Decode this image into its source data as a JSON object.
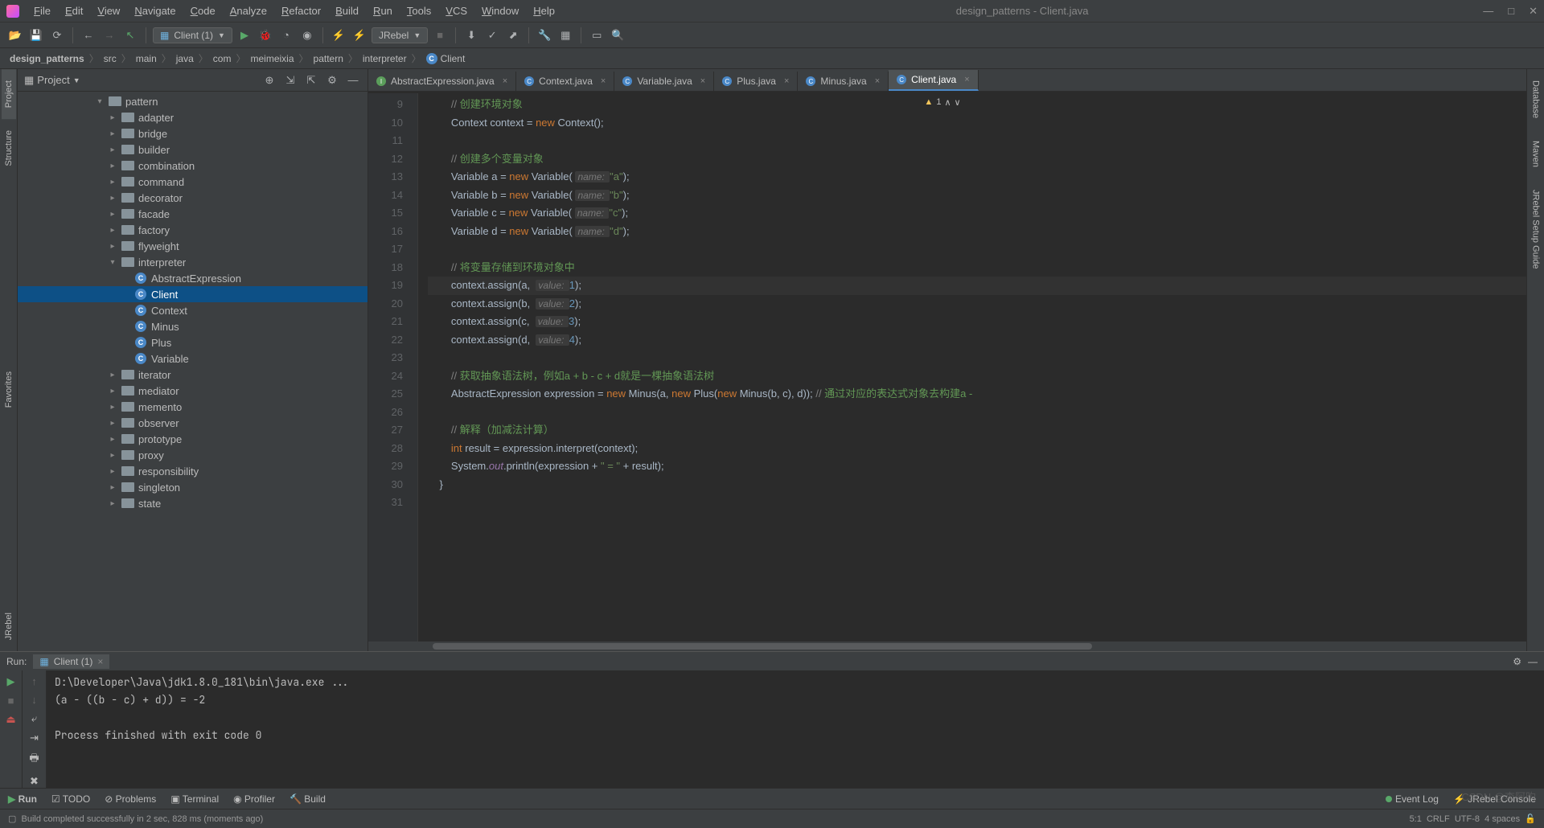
{
  "window": {
    "title": "design_patterns - Client.java"
  },
  "menu": [
    "File",
    "Edit",
    "View",
    "Navigate",
    "Code",
    "Analyze",
    "Refactor",
    "Build",
    "Run",
    "Tools",
    "VCS",
    "Window",
    "Help"
  ],
  "toolbar": {
    "run_config": "Client (1)",
    "jrebel": "JRebel"
  },
  "breadcrumb": [
    "design_patterns",
    "src",
    "main",
    "java",
    "com",
    "meimeixia",
    "pattern",
    "interpreter",
    "Client"
  ],
  "project": {
    "panel_title": "Project",
    "tree": [
      {
        "d": 6,
        "arrow": "v",
        "ico": "folder",
        "label": "pattern"
      },
      {
        "d": 7,
        "arrow": ">",
        "ico": "folder",
        "label": "adapter"
      },
      {
        "d": 7,
        "arrow": ">",
        "ico": "folder",
        "label": "bridge"
      },
      {
        "d": 7,
        "arrow": ">",
        "ico": "folder",
        "label": "builder"
      },
      {
        "d": 7,
        "arrow": ">",
        "ico": "folder",
        "label": "combination"
      },
      {
        "d": 7,
        "arrow": ">",
        "ico": "folder",
        "label": "command"
      },
      {
        "d": 7,
        "arrow": ">",
        "ico": "folder",
        "label": "decorator"
      },
      {
        "d": 7,
        "arrow": ">",
        "ico": "folder",
        "label": "facade"
      },
      {
        "d": 7,
        "arrow": ">",
        "ico": "folder",
        "label": "factory"
      },
      {
        "d": 7,
        "arrow": ">",
        "ico": "folder",
        "label": "flyweight"
      },
      {
        "d": 7,
        "arrow": "v",
        "ico": "folder",
        "label": "interpreter"
      },
      {
        "d": 8,
        "arrow": "",
        "ico": "class",
        "label": "AbstractExpression"
      },
      {
        "d": 8,
        "arrow": "",
        "ico": "class",
        "label": "Client",
        "sel": true
      },
      {
        "d": 8,
        "arrow": "",
        "ico": "class",
        "label": "Context"
      },
      {
        "d": 8,
        "arrow": "",
        "ico": "class",
        "label": "Minus"
      },
      {
        "d": 8,
        "arrow": "",
        "ico": "class",
        "label": "Plus"
      },
      {
        "d": 8,
        "arrow": "",
        "ico": "class",
        "label": "Variable"
      },
      {
        "d": 7,
        "arrow": ">",
        "ico": "folder",
        "label": "iterator"
      },
      {
        "d": 7,
        "arrow": ">",
        "ico": "folder",
        "label": "mediator"
      },
      {
        "d": 7,
        "arrow": ">",
        "ico": "folder",
        "label": "memento"
      },
      {
        "d": 7,
        "arrow": ">",
        "ico": "folder",
        "label": "observer"
      },
      {
        "d": 7,
        "arrow": ">",
        "ico": "folder",
        "label": "prototype"
      },
      {
        "d": 7,
        "arrow": ">",
        "ico": "folder",
        "label": "proxy"
      },
      {
        "d": 7,
        "arrow": ">",
        "ico": "folder",
        "label": "responsibility"
      },
      {
        "d": 7,
        "arrow": ">",
        "ico": "folder",
        "label": "singleton"
      },
      {
        "d": 7,
        "arrow": ">",
        "ico": "folder",
        "label": "state"
      }
    ]
  },
  "tabs": [
    {
      "label": "AbstractExpression.java",
      "ico": "iface"
    },
    {
      "label": "Context.java",
      "ico": "class"
    },
    {
      "label": "Variable.java",
      "ico": "class"
    },
    {
      "label": "Plus.java",
      "ico": "class"
    },
    {
      "label": "Minus.java",
      "ico": "class"
    },
    {
      "label": "Client.java",
      "ico": "class",
      "active": true
    }
  ],
  "editor": {
    "inspection_count": "1",
    "lines_start": 9,
    "lines_end": 31,
    "highlight_line": 19,
    "code": [
      {
        "indent": 8,
        "seg": [
          {
            "t": "// ",
            "c": "cm"
          },
          {
            "t": "创建环境对象",
            "c": "cmcn"
          }
        ]
      },
      {
        "indent": 8,
        "seg": [
          {
            "t": "Context context = "
          },
          {
            "t": "new ",
            "c": "kw"
          },
          {
            "t": "Context();"
          }
        ]
      },
      {
        "indent": 8,
        "seg": []
      },
      {
        "indent": 8,
        "seg": [
          {
            "t": "// ",
            "c": "cm"
          },
          {
            "t": "创建多个变量对象",
            "c": "cmcn"
          }
        ]
      },
      {
        "indent": 8,
        "seg": [
          {
            "t": "Variable a = "
          },
          {
            "t": "new ",
            "c": "kw"
          },
          {
            "t": "Variable( "
          },
          {
            "t": "name: ",
            "c": "hint"
          },
          {
            "t": "\"a\"",
            "c": "str"
          },
          {
            "t": ");"
          }
        ]
      },
      {
        "indent": 8,
        "seg": [
          {
            "t": "Variable b = "
          },
          {
            "t": "new ",
            "c": "kw"
          },
          {
            "t": "Variable( "
          },
          {
            "t": "name: ",
            "c": "hint"
          },
          {
            "t": "\"b\"",
            "c": "str"
          },
          {
            "t": ");"
          }
        ]
      },
      {
        "indent": 8,
        "seg": [
          {
            "t": "Variable c = "
          },
          {
            "t": "new ",
            "c": "kw"
          },
          {
            "t": "Variable( "
          },
          {
            "t": "name: ",
            "c": "hint"
          },
          {
            "t": "\"c\"",
            "c": "str"
          },
          {
            "t": ");"
          }
        ]
      },
      {
        "indent": 8,
        "seg": [
          {
            "t": "Variable d = "
          },
          {
            "t": "new ",
            "c": "kw"
          },
          {
            "t": "Variable( "
          },
          {
            "t": "name: ",
            "c": "hint"
          },
          {
            "t": "\"d\"",
            "c": "str"
          },
          {
            "t": ");"
          }
        ]
      },
      {
        "indent": 8,
        "seg": []
      },
      {
        "indent": 8,
        "seg": [
          {
            "t": "// ",
            "c": "cm"
          },
          {
            "t": "将变量存储到环境对象中",
            "c": "cmcn"
          }
        ]
      },
      {
        "indent": 8,
        "seg": [
          {
            "t": "context.assign(a,  "
          },
          {
            "t": "value: ",
            "c": "hint"
          },
          {
            "t": "1",
            "c": "num"
          },
          {
            "t": ");"
          }
        ],
        "hl": true
      },
      {
        "indent": 8,
        "seg": [
          {
            "t": "context.assign(b,  "
          },
          {
            "t": "value: ",
            "c": "hint"
          },
          {
            "t": "2",
            "c": "num"
          },
          {
            "t": ");"
          }
        ]
      },
      {
        "indent": 8,
        "seg": [
          {
            "t": "context.assign(c,  "
          },
          {
            "t": "value: ",
            "c": "hint"
          },
          {
            "t": "3",
            "c": "num"
          },
          {
            "t": ");"
          }
        ]
      },
      {
        "indent": 8,
        "seg": [
          {
            "t": "context.assign(d,  "
          },
          {
            "t": "value: ",
            "c": "hint"
          },
          {
            "t": "4",
            "c": "num"
          },
          {
            "t": ");"
          }
        ]
      },
      {
        "indent": 8,
        "seg": []
      },
      {
        "indent": 8,
        "seg": [
          {
            "t": "// ",
            "c": "cm"
          },
          {
            "t": "获取抽象语法树，例如a + b - c + d就是一棵抽象语法树",
            "c": "cmcn"
          }
        ]
      },
      {
        "indent": 8,
        "seg": [
          {
            "t": "AbstractExpression expression = "
          },
          {
            "t": "new ",
            "c": "kw"
          },
          {
            "t": "Minus(a, "
          },
          {
            "t": "new ",
            "c": "kw"
          },
          {
            "t": "Plus("
          },
          {
            "t": "new ",
            "c": "kw"
          },
          {
            "t": "Minus(b, c), d)); "
          },
          {
            "t": "// ",
            "c": "cm"
          },
          {
            "t": "通过对应的表达式对象去构建a -",
            "c": "cmcn"
          }
        ]
      },
      {
        "indent": 8,
        "seg": []
      },
      {
        "indent": 8,
        "seg": [
          {
            "t": "// ",
            "c": "cm"
          },
          {
            "t": "解释（加减法计算）",
            "c": "cmcn"
          }
        ]
      },
      {
        "indent": 8,
        "seg": [
          {
            "t": "int ",
            "c": "kw"
          },
          {
            "t": "result = expression.interpret(context);"
          }
        ]
      },
      {
        "indent": 8,
        "seg": [
          {
            "t": "System."
          },
          {
            "t": "out",
            "c": "fld"
          },
          {
            "t": ".println(expression + "
          },
          {
            "t": "\" = \"",
            "c": "str"
          },
          {
            "t": " + result);"
          }
        ]
      },
      {
        "indent": 4,
        "seg": [
          {
            "t": "}"
          }
        ]
      },
      {
        "indent": 0,
        "seg": [
          {
            "t": ""
          }
        ]
      }
    ]
  },
  "run": {
    "label": "Run:",
    "tab": "Client (1)",
    "console": [
      "D:\\Developer\\Java\\jdk1.8.0_181\\bin\\java.exe ...",
      "(a - ((b - c) + d)) = -2",
      "",
      "Process finished with exit code 0"
    ]
  },
  "left_tabs": [
    "Project",
    "Structure",
    "Favorites",
    "JRebel"
  ],
  "right_tabs": [
    "Database",
    "Maven",
    "JRebel Setup Guide"
  ],
  "bottom": {
    "items": [
      "Run",
      "TODO",
      "Problems",
      "Terminal",
      "Profiler",
      "Build"
    ],
    "right": [
      "Event Log",
      "JRebel Console"
    ]
  },
  "status": {
    "msg": "Build completed successfully in 2 sec, 828 ms (moments ago)",
    "pos": "5:1",
    "eol": "CRLF",
    "enc": "UTF-8",
    "indent": "4 spaces"
  },
  "watermark": "CSDN @李阿昀"
}
